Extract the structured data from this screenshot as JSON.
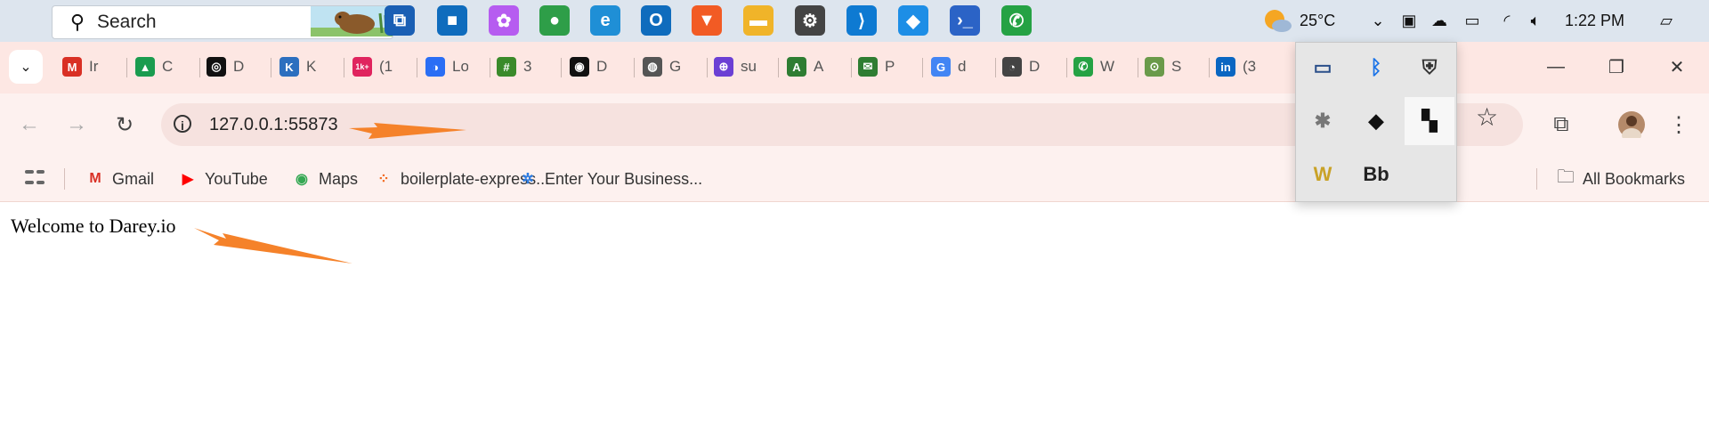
{
  "taskbar": {
    "search_label": "Search",
    "temperature": "25°C",
    "time": "1:22 PM",
    "pinned_apps": [
      {
        "name": "task-view",
        "glyph": "⧉",
        "color": "#1a5fb4"
      },
      {
        "name": "microsoft-store",
        "glyph": "■",
        "color": "#0f6cbd"
      },
      {
        "name": "copilot",
        "glyph": "✿",
        "color": "#b65cf0"
      },
      {
        "name": "chrome",
        "glyph": "●",
        "color": "#2e9e48"
      },
      {
        "name": "edge",
        "glyph": "e",
        "color": "#1f8fd6"
      },
      {
        "name": "outlook",
        "glyph": "O",
        "color": "#0f6cbd"
      },
      {
        "name": "brave",
        "glyph": "▼",
        "color": "#f25b24"
      },
      {
        "name": "file-explorer",
        "glyph": "▬",
        "color": "#f0b429"
      },
      {
        "name": "settings",
        "glyph": "⚙",
        "color": "#444444"
      },
      {
        "name": "vscode",
        "glyph": "⟩",
        "color": "#0e7ad2"
      },
      {
        "name": "docker",
        "glyph": "◆",
        "color": "#1d8ee6"
      },
      {
        "name": "powershell",
        "glyph": "›_",
        "color": "#2b63c6"
      },
      {
        "name": "whatsapp",
        "glyph": "✆",
        "color": "#25a244"
      }
    ]
  },
  "tabs": [
    {
      "favicon": "M",
      "color": "#d93025",
      "label": "Ir"
    },
    {
      "favicon": "▲",
      "color": "#1a9c4f",
      "label": "C"
    },
    {
      "favicon": "◎",
      "color": "#111111",
      "label": "D"
    },
    {
      "favicon": "K",
      "color": "#2c6fbf",
      "label": "K"
    },
    {
      "favicon": "1k+",
      "color": "#e0245e",
      "label": "(1"
    },
    {
      "favicon": "◑",
      "color": "#2a6ef5",
      "label": "Lo"
    },
    {
      "favicon": "#",
      "color": "#3a8a2a",
      "label": "3"
    },
    {
      "favicon": "◉",
      "color": "#111111",
      "label": "D"
    },
    {
      "favicon": "◍",
      "color": "#555555",
      "label": "G"
    },
    {
      "favicon": "⊕",
      "color": "#6b3fd4",
      "label": "su"
    },
    {
      "favicon": "A",
      "color": "#2e7d32",
      "label": "A"
    },
    {
      "favicon": "✉",
      "color": "#2e7d32",
      "label": "P"
    },
    {
      "favicon": "G",
      "color": "#4285f4",
      "label": "d"
    },
    {
      "favicon": "◔",
      "color": "#444444",
      "label": "D"
    },
    {
      "favicon": "✆",
      "color": "#25a244",
      "label": "W"
    },
    {
      "favicon": "⊙",
      "color": "#6a9a4a",
      "label": "S"
    },
    {
      "favicon": "in",
      "color": "#0a66c2",
      "label": "(3"
    }
  ],
  "toolbar": {
    "url": "127.0.0.1:55873"
  },
  "bookmarks": {
    "items": [
      {
        "label": "Gmail",
        "icon": "gmail-icon",
        "glyph": "M",
        "color": "#d93025"
      },
      {
        "label": "YouTube",
        "icon": "youtube-icon",
        "glyph": "▶",
        "color": "#ff0000"
      },
      {
        "label": "Maps",
        "icon": "maps-icon",
        "glyph": "◉",
        "color": "#34a853"
      },
      {
        "label": "boilerplate-express...",
        "icon": "boilerplate-icon",
        "glyph": "⁘",
        "color": "#f26b21"
      },
      {
        "label": "Enter Your Business...",
        "icon": "business-icon",
        "glyph": "✲",
        "color": "#2f7de1"
      }
    ],
    "all_bookmarks_label": "All Bookmarks"
  },
  "page": {
    "heading": "Welcome to Darey.io"
  },
  "tray_flyout": {
    "items": [
      {
        "name": "display-icon",
        "glyph": "▭",
        "color": "#2b4f8a"
      },
      {
        "name": "bluetooth-icon",
        "glyph": "ᛒ",
        "color": "#1a73e8"
      },
      {
        "name": "security-shield-icon",
        "glyph": "⛨",
        "color": "#333333"
      },
      {
        "name": "slack-icon",
        "glyph": "✱",
        "color": "#777777"
      },
      {
        "name": "docker-icon",
        "glyph": "◆",
        "color": "#111111"
      },
      {
        "name": "bookmark-app-icon",
        "glyph": "▚",
        "color": "#111111"
      },
      {
        "name": "word-icon",
        "glyph": "W",
        "color": "#c9a227"
      },
      {
        "name": "app-bb-icon",
        "glyph": "Bb",
        "color": "#222222"
      }
    ]
  },
  "colors": {
    "taskbar_bg": "#dde5ee",
    "tabstrip_bg": "#fde7e3",
    "toolbar_bg": "#fdf1ef",
    "annotation_arrow": "#f5822a"
  }
}
